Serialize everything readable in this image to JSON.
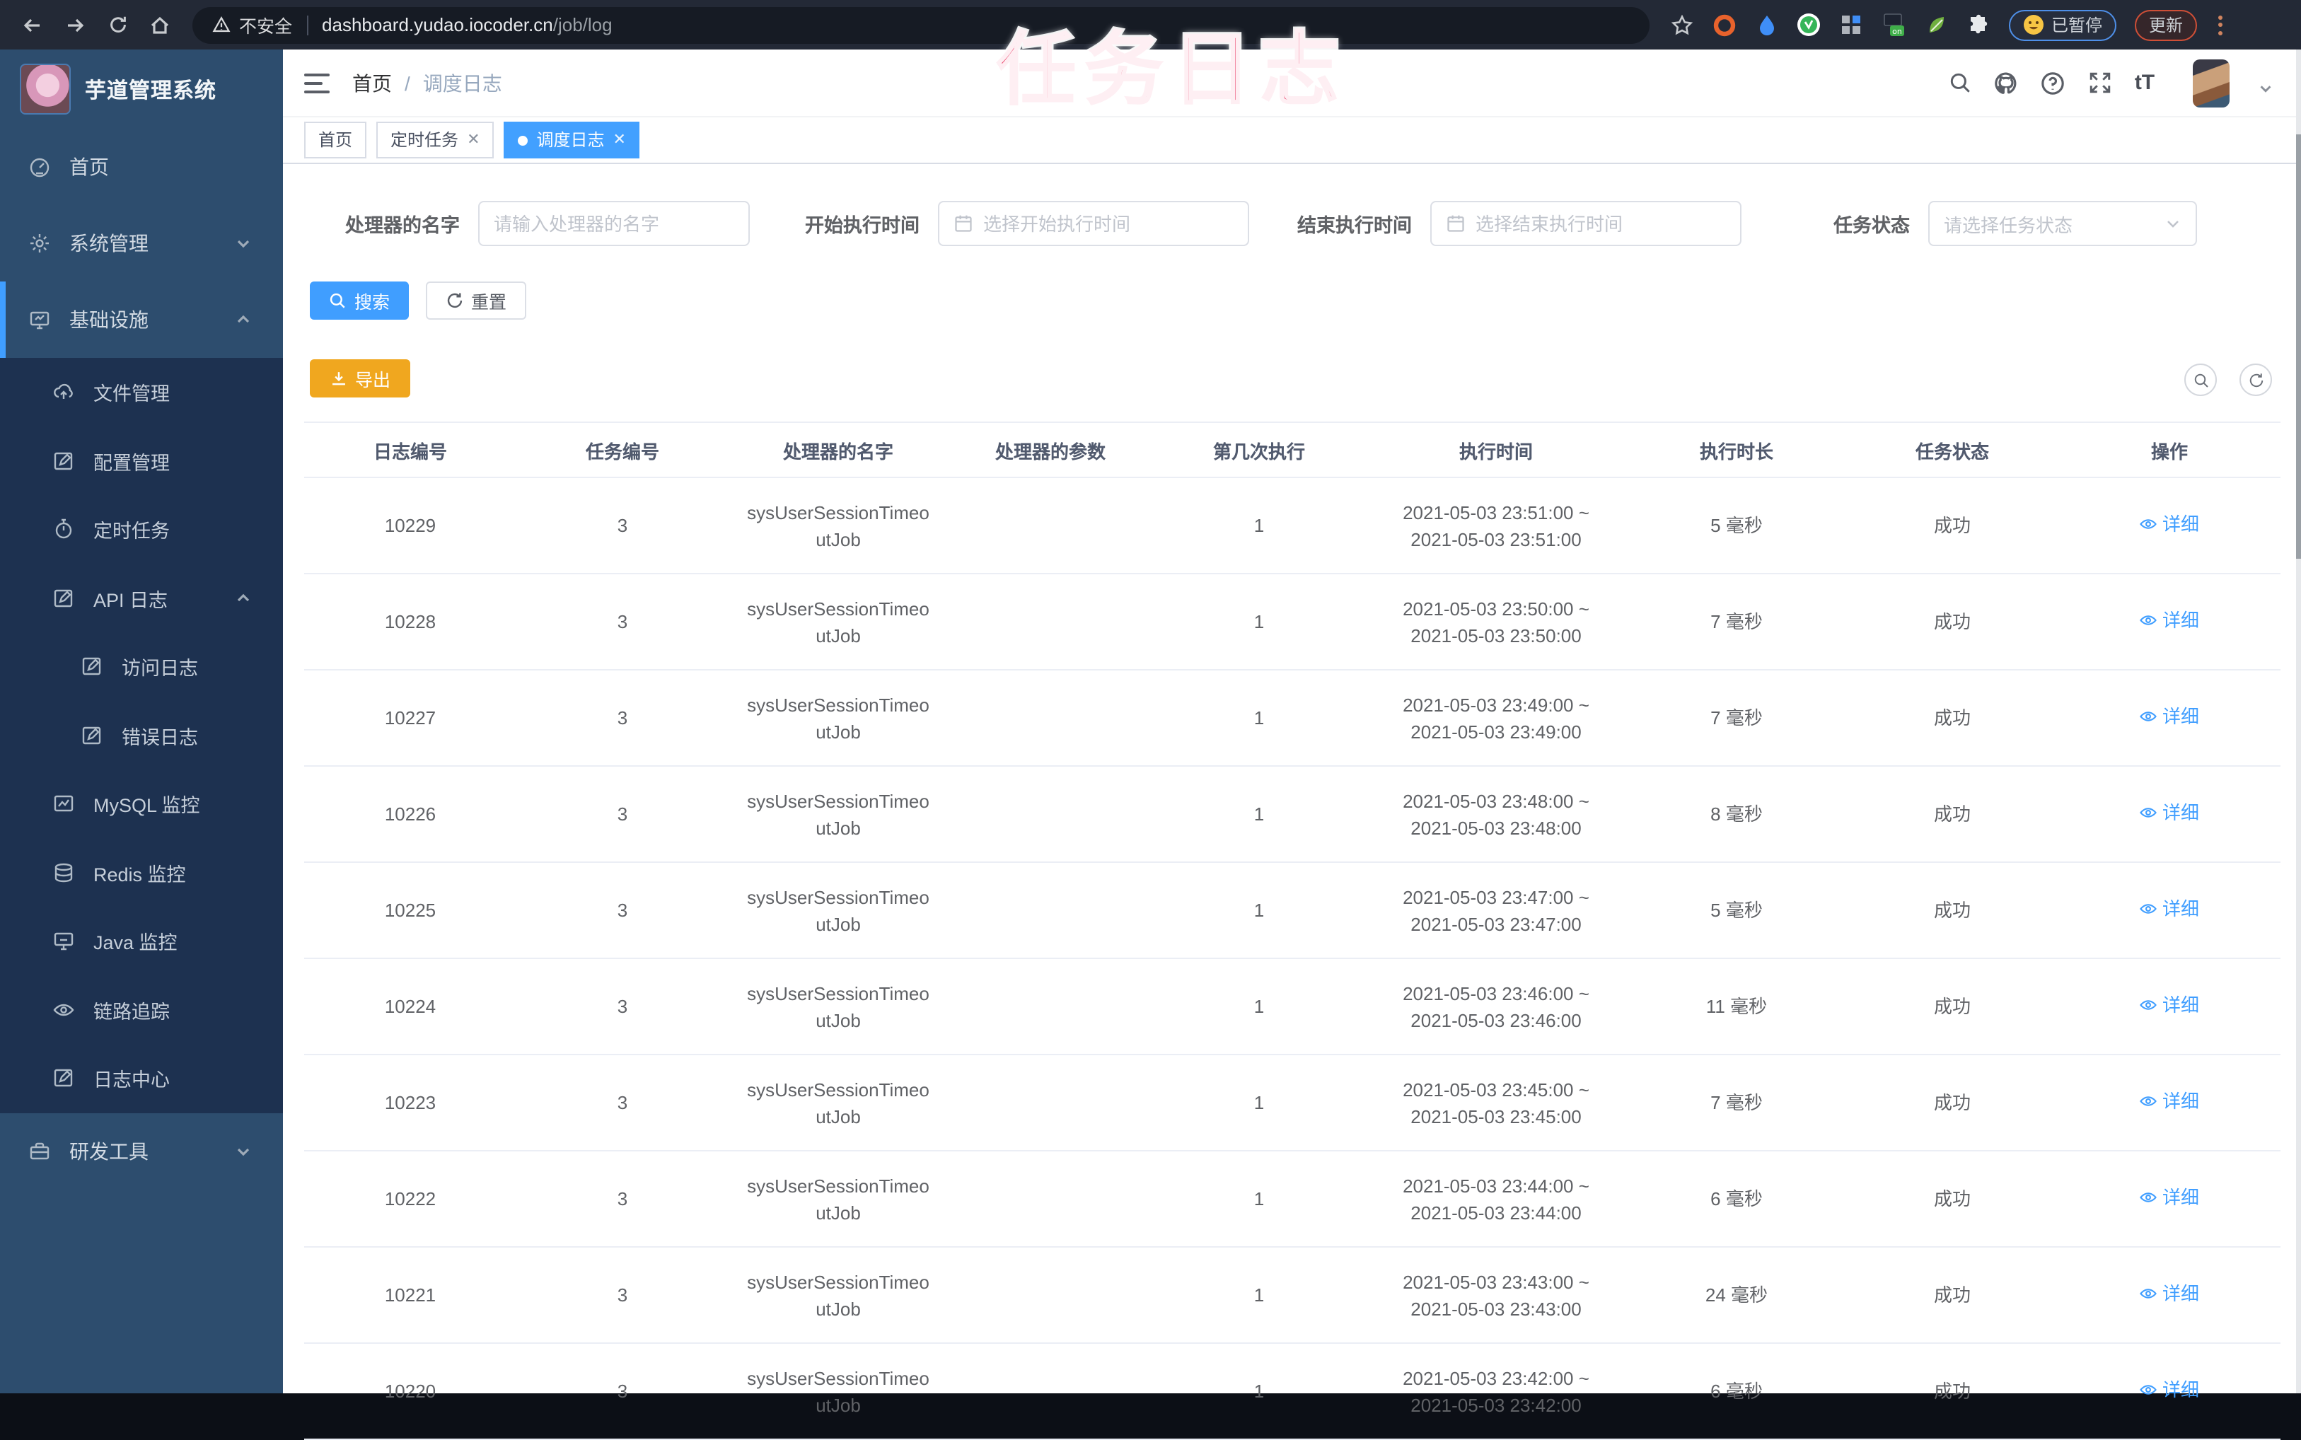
{
  "colors": {
    "accent": "#409eff",
    "warning": "#f0a71f",
    "overlay_pink": "#e93a64",
    "sidebar_bg": "#2d4d6e",
    "submenu_bg": "#1d3150",
    "active_tab": "#42a0ff"
  },
  "overlay_title": "任务日志",
  "browser": {
    "security_label": "不安全",
    "url_host": "dashboard.yudao.iocoder.cn",
    "url_path": "/job/log",
    "paused_badge_label": "已暂停",
    "update_button_label": "更新"
  },
  "sidebar": {
    "app_title": "芋道管理系统",
    "items": [
      {
        "label": "首页"
      },
      {
        "label": "系统管理"
      },
      {
        "label": "基础设施"
      },
      {
        "label": "文件管理"
      },
      {
        "label": "配置管理"
      },
      {
        "label": "定时任务"
      },
      {
        "label": "API 日志"
      },
      {
        "label": "访问日志"
      },
      {
        "label": "错误日志"
      },
      {
        "label": "MySQL 监控"
      },
      {
        "label": "Redis 监控"
      },
      {
        "label": "Java 监控"
      },
      {
        "label": "链路追踪"
      },
      {
        "label": "日志中心"
      },
      {
        "label": "研发工具"
      }
    ]
  },
  "topbar": {
    "breadcrumb": {
      "home": "首页",
      "separator": "/",
      "current": "调度日志"
    }
  },
  "tabs": [
    {
      "label": "首页"
    },
    {
      "label": "定时任务"
    },
    {
      "label": "调度日志"
    }
  ],
  "filters": {
    "handler_label": "处理器的名字",
    "handler_placeholder": "请输入处理器的名字",
    "begin_label": "开始执行时间",
    "begin_placeholder": "选择开始执行时间",
    "end_label": "结束执行时间",
    "end_placeholder": "选择结束执行时间",
    "status_label": "任务状态",
    "status_placeholder": "请选择任务状态"
  },
  "buttons": {
    "search": "搜索",
    "reset": "重置",
    "export": "导出"
  },
  "table": {
    "headers": [
      "日志编号",
      "任务编号",
      "处理器的名字",
      "处理器的参数",
      "第几次执行",
      "执行时间",
      "执行时长",
      "任务状态",
      "操作"
    ],
    "rows": [
      {
        "log_id": "10229",
        "job_id": "3",
        "handler": "sysUserSessionTimeoutJob",
        "param": "",
        "index": "1",
        "time1": "2021-05-03 23:51:00 ~",
        "time2": "2021-05-03 23:51:00",
        "duration": "5 毫秒",
        "status": "成功",
        "detail": "详细"
      },
      {
        "log_id": "10228",
        "job_id": "3",
        "handler": "sysUserSessionTimeoutJob",
        "param": "",
        "index": "1",
        "time1": "2021-05-03 23:50:00 ~",
        "time2": "2021-05-03 23:50:00",
        "duration": "7 毫秒",
        "status": "成功",
        "detail": "详细"
      },
      {
        "log_id": "10227",
        "job_id": "3",
        "handler": "sysUserSessionTimeoutJob",
        "param": "",
        "index": "1",
        "time1": "2021-05-03 23:49:00 ~",
        "time2": "2021-05-03 23:49:00",
        "duration": "7 毫秒",
        "status": "成功",
        "detail": "详细"
      },
      {
        "log_id": "10226",
        "job_id": "3",
        "handler": "sysUserSessionTimeoutJob",
        "param": "",
        "index": "1",
        "time1": "2021-05-03 23:48:00 ~",
        "time2": "2021-05-03 23:48:00",
        "duration": "8 毫秒",
        "status": "成功",
        "detail": "详细"
      },
      {
        "log_id": "10225",
        "job_id": "3",
        "handler": "sysUserSessionTimeoutJob",
        "param": "",
        "index": "1",
        "time1": "2021-05-03 23:47:00 ~",
        "time2": "2021-05-03 23:47:00",
        "duration": "5 毫秒",
        "status": "成功",
        "detail": "详细"
      },
      {
        "log_id": "10224",
        "job_id": "3",
        "handler": "sysUserSessionTimeoutJob",
        "param": "",
        "index": "1",
        "time1": "2021-05-03 23:46:00 ~",
        "time2": "2021-05-03 23:46:00",
        "duration": "11 毫秒",
        "status": "成功",
        "detail": "详细"
      },
      {
        "log_id": "10223",
        "job_id": "3",
        "handler": "sysUserSessionTimeoutJob",
        "param": "",
        "index": "1",
        "time1": "2021-05-03 23:45:00 ~",
        "time2": "2021-05-03 23:45:00",
        "duration": "7 毫秒",
        "status": "成功",
        "detail": "详细"
      },
      {
        "log_id": "10222",
        "job_id": "3",
        "handler": "sysUserSessionTimeoutJob",
        "param": "",
        "index": "1",
        "time1": "2021-05-03 23:44:00 ~",
        "time2": "2021-05-03 23:44:00",
        "duration": "6 毫秒",
        "status": "成功",
        "detail": "详细"
      },
      {
        "log_id": "10221",
        "job_id": "3",
        "handler": "sysUserSessionTimeoutJob",
        "param": "",
        "index": "1",
        "time1": "2021-05-03 23:43:00 ~",
        "time2": "2021-05-03 23:43:00",
        "duration": "24 毫秒",
        "status": "成功",
        "detail": "详细"
      },
      {
        "log_id": "10220",
        "job_id": "3",
        "handler": "sysUserSessionTimeoutJob",
        "param": "",
        "index": "1",
        "time1": "2021-05-03 23:42:00 ~",
        "time2": "2021-05-03 23:42:00",
        "duration": "6 毫秒",
        "status": "成功",
        "detail": "详细"
      }
    ]
  }
}
